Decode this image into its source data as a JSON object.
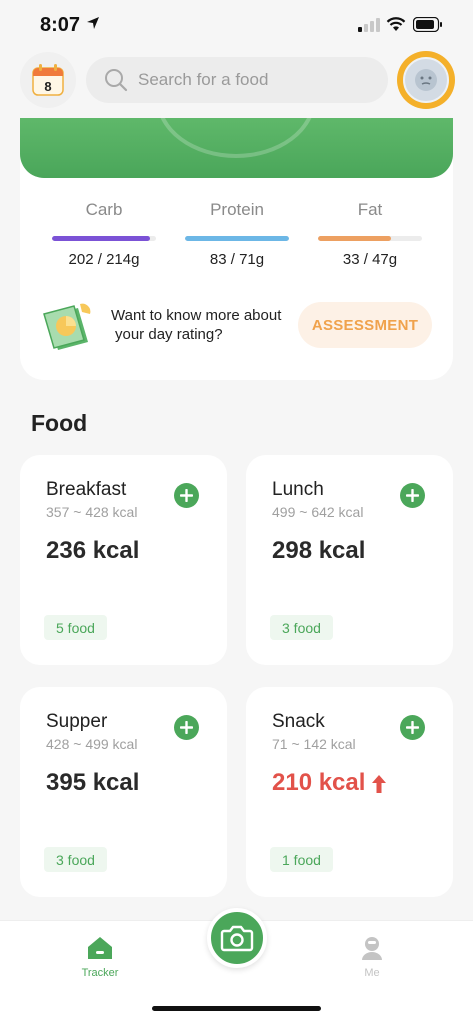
{
  "status_bar": {
    "time": "8:07"
  },
  "header": {
    "calendar_day": "8",
    "search_placeholder": "Search for a food"
  },
  "macros": [
    {
      "name": "Carb",
      "value": "202 / 214g",
      "progress": 0.94,
      "color": "#7b52d6"
    },
    {
      "name": "Protein",
      "value": "83 / 71g",
      "progress": 1.0,
      "color": "#6cb7e6"
    },
    {
      "name": "Fat",
      "value": "33 / 47g",
      "progress": 0.7,
      "color": "#eda061"
    }
  ],
  "rating": {
    "line1": "Want to know more about",
    "line2": "your day rating?",
    "button": "ASSESSMENT"
  },
  "food": {
    "title": "Food",
    "meals": [
      {
        "name": "Breakfast",
        "range": "357 ~ 428 kcal",
        "kcal": "236 kcal",
        "count": "5 food",
        "over": false
      },
      {
        "name": "Lunch",
        "range": "499 ~ 642 kcal",
        "kcal": "298 kcal",
        "count": "3 food",
        "over": false
      },
      {
        "name": "Supper",
        "range": "428 ~ 499 kcal",
        "kcal": "395 kcal",
        "count": "3 food",
        "over": false
      },
      {
        "name": "Snack",
        "range": "71 ~ 142 kcal",
        "kcal": "210 kcal",
        "count": "1 food",
        "over": true
      }
    ]
  },
  "tabs": [
    {
      "label": "Tracker",
      "icon": "home-icon",
      "active": true
    },
    {
      "label": "Me",
      "icon": "person-icon",
      "active": false
    }
  ],
  "colors": {
    "accent_green": "#4ba75a",
    "assessment_orange": "#f0a24c",
    "over_red": "#e2524a"
  }
}
